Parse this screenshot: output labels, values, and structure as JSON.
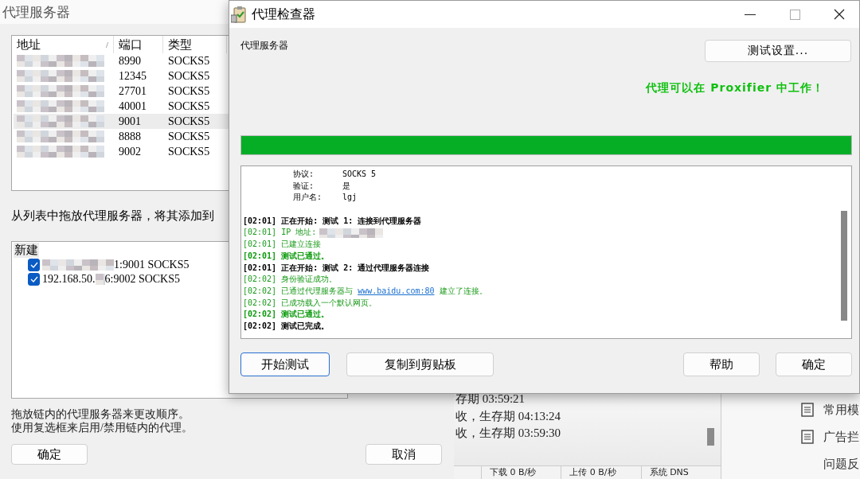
{
  "proxy_window": {
    "title": "代理服务器",
    "columns": [
      {
        "label": "地址",
        "sort_mark": "/"
      },
      {
        "label": "端口"
      },
      {
        "label": "类型"
      }
    ],
    "rows": [
      {
        "port": "8990",
        "type": "SOCKS5",
        "selected": false
      },
      {
        "port": "12345",
        "type": "SOCKS5",
        "selected": false
      },
      {
        "port": "27701",
        "type": "SOCKS5",
        "selected": false
      },
      {
        "port": "40001",
        "type": "SOCKS5",
        "selected": false
      },
      {
        "port": "9001",
        "type": "SOCKS5",
        "selected": true
      },
      {
        "port": "8888",
        "type": "SOCKS5",
        "selected": false
      },
      {
        "port": "9002",
        "type": "SOCKS5",
        "selected": false
      }
    ],
    "chain_label": "从列表中拖放代理服务器，将其添加到",
    "chain": {
      "name": "新建",
      "items": [
        {
          "suffix": "1:9001 SOCKS5",
          "checked": true
        },
        {
          "prefix": "192.168.50.",
          "suffix": "6:9002 SOCKS5",
          "checked": true
        }
      ]
    },
    "hint_lines": [
      "拖放链内的代理服务器来更改顺序。",
      "使用复选框来启用/禁用链内的代理。"
    ],
    "buttons": [
      "确定",
      "取消"
    ]
  },
  "back_window": {
    "log_lines": [
      "存期 03:59:21",
      "收，生存期 04:13:24",
      "收，生存期 03:59:30"
    ],
    "status": [
      "下载 0 B/秒",
      "上传 0 B/秒",
      "系统 DNS"
    ],
    "side_items": [
      {
        "label": "常用模",
        "kind": "icon"
      },
      {
        "label": "广告拦",
        "kind": "icon"
      },
      {
        "label": "问题反",
        "kind": "plain"
      }
    ]
  },
  "checker": {
    "title": "代理检查器",
    "label": "代理服务器",
    "settings_button": "测试设置...",
    "result": "代理可以在 Proxifier 中工作！",
    "progress": {
      "level": 1
    },
    "log": [
      {
        "kind": "field",
        "label": "协议:",
        "value": "SOCKS 5"
      },
      {
        "kind": "field",
        "label": "验证:",
        "value": "是"
      },
      {
        "kind": "field",
        "label": "用户名:",
        "value": "lgj"
      },
      {
        "kind": "blank"
      },
      {
        "kind": "heading",
        "text": "[02:01] 正在开始: 测试 1: 连接到代理服务器"
      },
      {
        "kind": "masked",
        "text": "[02:01] IP 地址:"
      },
      {
        "kind": "ok",
        "text": "[02:01] 已建立连接"
      },
      {
        "kind": "pass",
        "text": "[02:01] 测试已通过。"
      },
      {
        "kind": "heading",
        "text": "[02:01] 正在开始: 测试 2: 通过代理服务器连接"
      },
      {
        "kind": "ok",
        "text": "[02:02] 身份验证成功。"
      },
      {
        "kind": "link",
        "text": "[02:02] 已通过代理服务器与",
        "link": "www.baidu.com:80",
        "after": "建立了连接。"
      },
      {
        "kind": "ok",
        "text": "[02:02] 已成功载入一个默认网页。"
      },
      {
        "kind": "pass",
        "text": "[02:02] 测试已通过。"
      },
      {
        "kind": "heading",
        "text": "[02:02] 测试已完成。"
      }
    ],
    "buttons": [
      {
        "label": "开始测试",
        "focused": true
      },
      {
        "label": "复制到剪贴板",
        "focused": false
      },
      {
        "label": "帮助",
        "focused": false
      },
      {
        "label": "确定",
        "focused": false
      }
    ]
  }
}
